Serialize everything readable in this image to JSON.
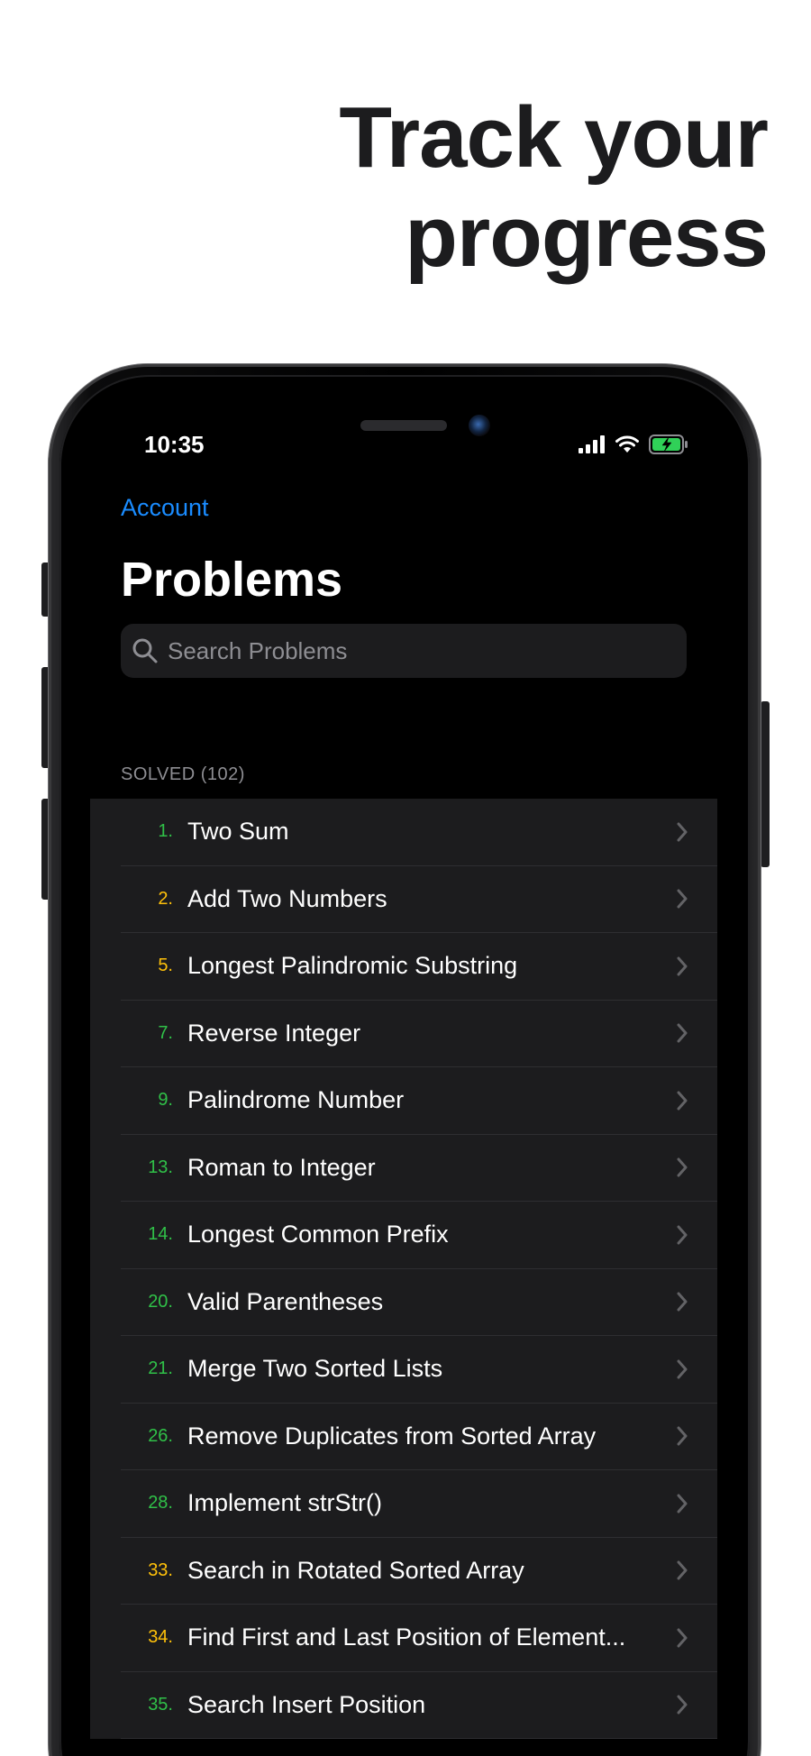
{
  "headline": {
    "line1": "Track your",
    "line2": "progress"
  },
  "status_bar": {
    "time": "10:35",
    "battery_color": "#30d158"
  },
  "nav": {
    "account_label": "Account",
    "title": "Problems"
  },
  "search": {
    "placeholder": "Search Problems",
    "value": ""
  },
  "section": {
    "header": "SOLVED (102)"
  },
  "colors": {
    "accent": "#1a8cff",
    "easy": "#30c048",
    "medium": "#ffc10a"
  },
  "problems": [
    {
      "number": "1.",
      "title": "Two Sum",
      "difficulty": "easy"
    },
    {
      "number": "2.",
      "title": "Add Two Numbers",
      "difficulty": "medium"
    },
    {
      "number": "5.",
      "title": "Longest Palindromic Substring",
      "difficulty": "medium"
    },
    {
      "number": "7.",
      "title": "Reverse Integer",
      "difficulty": "easy"
    },
    {
      "number": "9.",
      "title": "Palindrome Number",
      "difficulty": "easy"
    },
    {
      "number": "13.",
      "title": "Roman to Integer",
      "difficulty": "easy"
    },
    {
      "number": "14.",
      "title": "Longest Common Prefix",
      "difficulty": "easy"
    },
    {
      "number": "20.",
      "title": "Valid Parentheses",
      "difficulty": "easy"
    },
    {
      "number": "21.",
      "title": "Merge Two Sorted Lists",
      "difficulty": "easy"
    },
    {
      "number": "26.",
      "title": "Remove Duplicates from Sorted Array",
      "difficulty": "easy"
    },
    {
      "number": "28.",
      "title": "Implement strStr()",
      "difficulty": "easy"
    },
    {
      "number": "33.",
      "title": "Search in Rotated Sorted Array",
      "difficulty": "medium"
    },
    {
      "number": "34.",
      "title": "Find First and Last Position of Element...",
      "difficulty": "medium"
    },
    {
      "number": "35.",
      "title": "Search Insert Position",
      "difficulty": "easy"
    }
  ]
}
